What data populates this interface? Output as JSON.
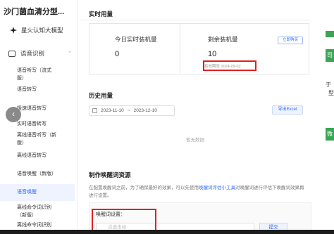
{
  "sidebar": {
    "app_title": "沙门菌血清分型...",
    "model_item": "星火认知大模型",
    "group_label": "语音识别",
    "items": [
      {
        "label": "语音听写（流式"
      },
      {
        "label": "版）"
      },
      {
        "label": "语音转写"
      },
      {
        "label": "极速语音转写"
      },
      {
        "label": "实时语音转写"
      },
      {
        "label": "离线语音听写（新"
      },
      {
        "label": "版）"
      },
      {
        "label": "离线语音转写"
      },
      {
        "label": "语音唤醒（新版）"
      },
      {
        "label": "语音唤醒"
      },
      {
        "label": "离线命令词识别"
      },
      {
        "label": "（新版）"
      },
      {
        "label": "离线命令词识别"
      }
    ],
    "collapse_glyph": "‹"
  },
  "realtime": {
    "title": "实时用量",
    "today_label": "今日实时装机量",
    "today_value": "0",
    "remaining_label": "剩余装机量",
    "remaining_value": "10",
    "buy_button": "立即购买",
    "expire_text": "有效期至 2024-09-02"
  },
  "history": {
    "title": "历史用量",
    "date_start": "2023-11-10",
    "date_sep": "~",
    "date_end": "2023-12-10",
    "export_button": "导出Excel",
    "empty_text": "暂无数据"
  },
  "wake": {
    "title": "制作唤醒词资源",
    "desc_before": "在配置唤醒词之前，为了确保最好的效果，可以先使用",
    "desc_link": "唤醒词评估小工具",
    "desc_after": "对唤醒词进行评估下唤醒词效果再进行设置。",
    "label": "唤醒词设置：",
    "input_placeholder": "点选击动",
    "submit_button": "提交"
  },
  "right_strip": {
    "chars": [
      "司",
      "于",
      "型",
      "微"
    ]
  },
  "colors": {
    "accent": "#2f6bff",
    "highlight": "#e02020",
    "green": "#3aa655"
  }
}
